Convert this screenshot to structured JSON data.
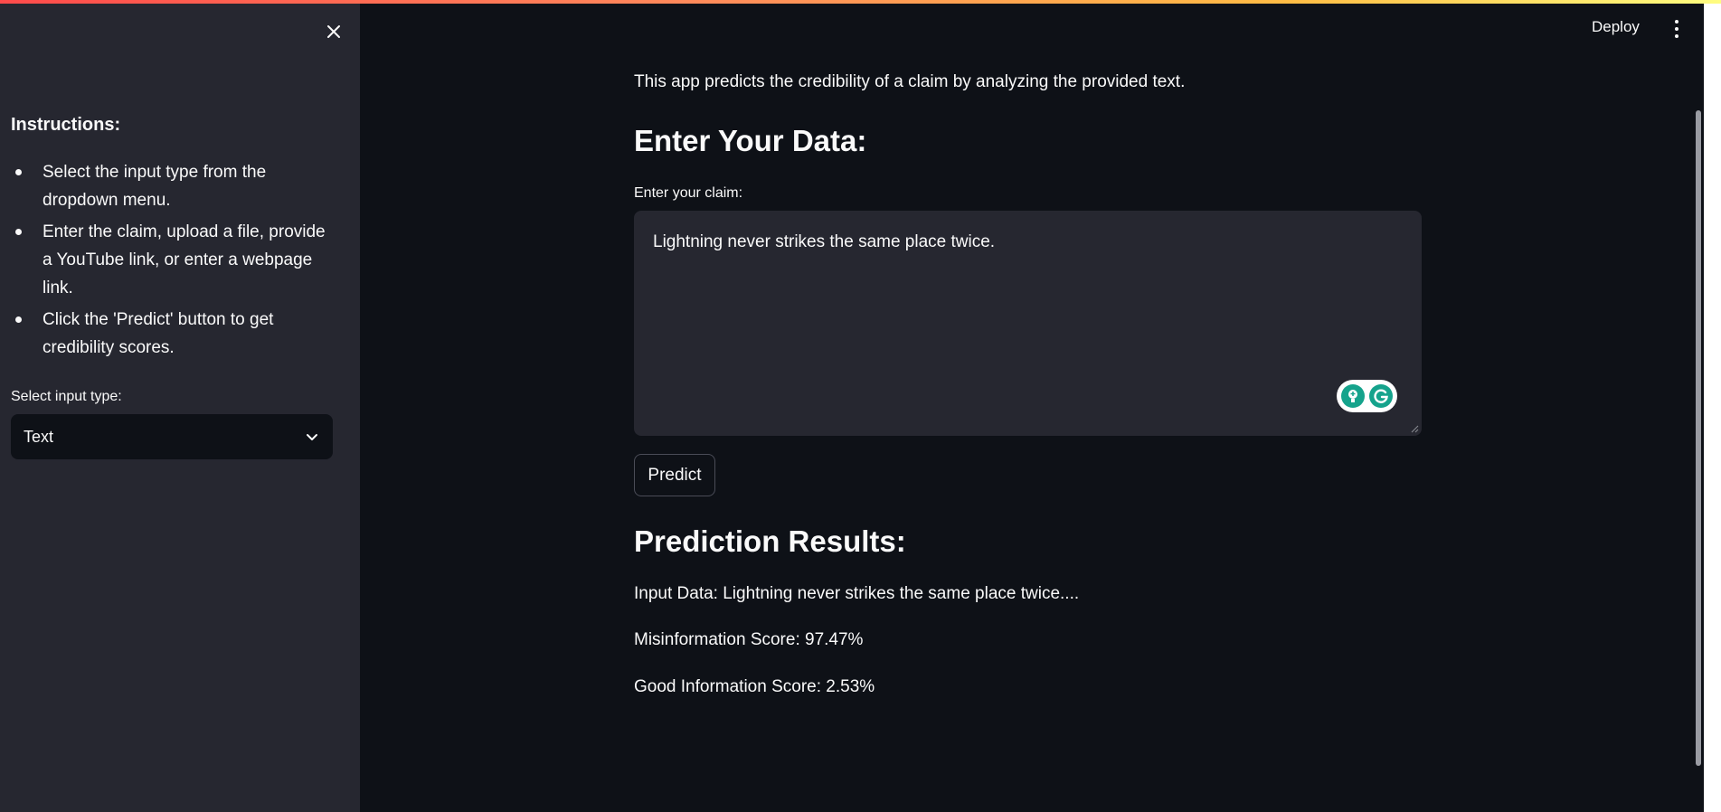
{
  "sidebar": {
    "close_icon": "close-icon",
    "heading": "Instructions:",
    "items": [
      {
        "label": "Select the input type from the dropdown menu."
      },
      {
        "label": "Enter the claim, upload a file, provide a YouTube link, or enter a webpage link."
      },
      {
        "label": "Click the 'Predict' button to get credibility scores."
      }
    ],
    "select_label": "Select input type:",
    "select_value": "Text"
  },
  "header": {
    "deploy_label": "Deploy",
    "menu_icon": "kebab-menu-icon"
  },
  "main": {
    "intro": "This app predicts the credibility of a claim by analyzing the provided text.",
    "enter_heading": "Enter Your Data:",
    "claim_label": "Enter your claim:",
    "claim_value": "Lightning never strikes the same place twice.",
    "predict_label": "Predict",
    "results_heading": "Prediction Results:",
    "input_data": "Input Data: Lightning never strikes the same place twice....",
    "misinformation_score": "Misinformation Score: 97.47%",
    "good_information_score": "Good Information Score: 2.53%"
  },
  "colors": {
    "background": "#0e1117",
    "sidebar": "#262730",
    "text": "#fafafa",
    "grammarly": "#15a38c"
  }
}
